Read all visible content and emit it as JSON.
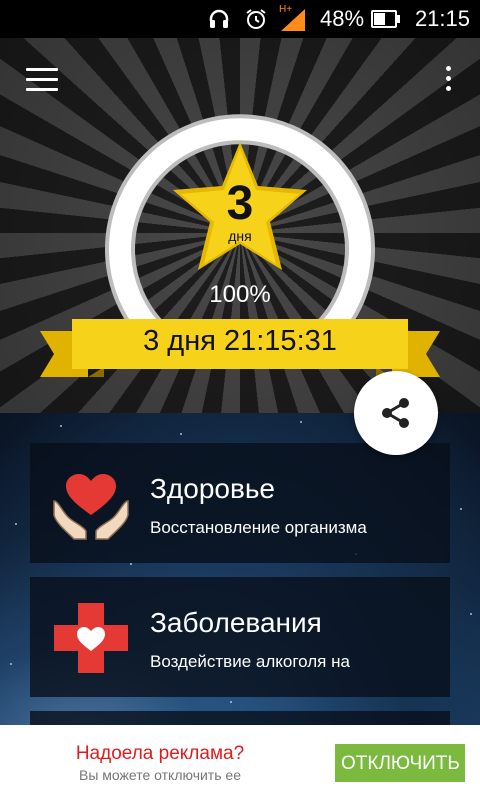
{
  "status_bar": {
    "network_label": "H+",
    "battery_percent": "48%",
    "time": "21:15",
    "icons": [
      "headset-icon",
      "alarm-icon",
      "signal-icon",
      "battery-icon"
    ]
  },
  "toolbar": {
    "menu_icon": "hamburger-menu-icon",
    "more_icon": "more-vert-icon"
  },
  "counter": {
    "days_number": "3",
    "days_unit": "дня",
    "progress_percent": "100%",
    "progress_fraction": 1.0,
    "timer": "3 дня 21:15:31"
  },
  "share": {
    "icon": "share-icon"
  },
  "cards": [
    {
      "title": "Здоровье",
      "subtitle": "Восстановление организма",
      "icon": "heart-hands-icon"
    },
    {
      "title": "Заболевания",
      "subtitle": "Воздействие алкоголя на",
      "icon": "medical-cross-heart-icon"
    }
  ],
  "ad": {
    "title": "Надоела реклама?",
    "subtitle": "Вы можете отключить ее",
    "button_label": "ОТКЛЮЧИТЬ"
  },
  "colors": {
    "accent_yellow": "#f7d21b",
    "ring": "#ffffff",
    "ad_title": "#e31b1b",
    "ad_button": "#7bb93f",
    "heart_red": "#e53935"
  }
}
